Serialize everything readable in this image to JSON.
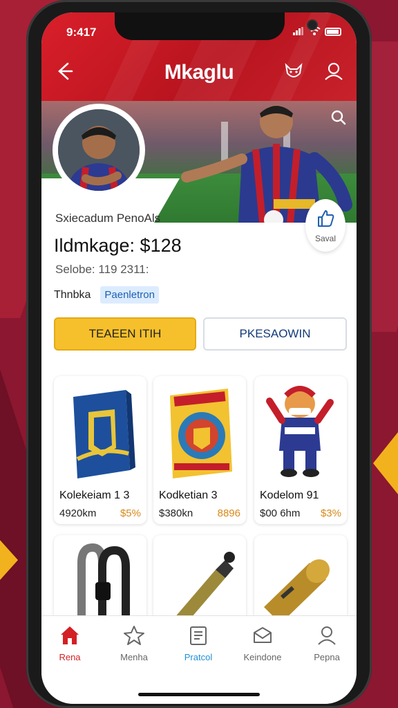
{
  "status_bar": {
    "time": "9:417"
  },
  "header": {
    "title": "Mkaglu"
  },
  "profile": {
    "name": "Sxiecadum PenoAls",
    "share_label": "Saval"
  },
  "product": {
    "headline": "Ildmkage: $128",
    "subline": "Selobe: 119 2311:",
    "tag_label": "Thnbka",
    "tag_value": "Paenletron"
  },
  "buttons": {
    "primary": "TEAEEN ITIH",
    "secondary": "PKESAOWIN"
  },
  "collection": [
    {
      "name": "Kolekeiam 1 3",
      "price": "4920km",
      "discount": "$5%"
    },
    {
      "name": "Kodketian 3",
      "price": "$380kn",
      "discount": "8896"
    },
    {
      "name": "Kodelom 91",
      "price": "$00 6hm",
      "discount": "$3%"
    }
  ],
  "tabs": [
    {
      "label": "Rena",
      "icon": "home-icon",
      "active": true
    },
    {
      "label": "Menha",
      "icon": "star-icon",
      "active": false
    },
    {
      "label": "Pratcol",
      "icon": "document-icon",
      "active": false
    },
    {
      "label": "Keindone",
      "icon": "gift-icon",
      "active": false
    },
    {
      "label": "Pepna",
      "icon": "person-icon",
      "active": false
    }
  ],
  "colors": {
    "brand_red": "#d91f2a",
    "accent_yellow": "#f6c02c",
    "tag_blue": "#1f5fb0",
    "discount_orange": "#d8891c",
    "active_tab": "#d32024"
  }
}
